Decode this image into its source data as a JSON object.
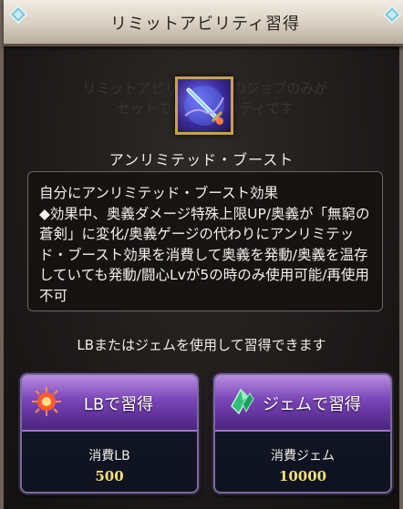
{
  "dialog": {
    "title": "リミットアビリティ習得",
    "background_text": "リミットアビリティはこのジョブのみが\nセットできるアビリティです"
  },
  "skill": {
    "icon": "sword-burst-icon",
    "name": "アンリミテッド・ブースト",
    "description": "自分にアンリミテッド・ブースト効果\n◆効果中、奥義ダメージ特殊上限UP/奥義が「無窮の蒼剣」に変化/奥義ゲージの代わりにアンリミテッド・ブースト効果を消費して奥義を発動/奥義を温存していても発動/闘心Lvが5の時のみ使用可能/再使用不可"
  },
  "learn_note": "LBまたはジェムを使用して習得できます",
  "buttons": {
    "lb": {
      "label": "LBで習得",
      "icon": "lb-burst-icon",
      "cost_label": "消費LB",
      "cost_value": "500"
    },
    "gem": {
      "label": "ジェムで習得",
      "icon": "gem-crystal-icon",
      "cost_label": "消費ジェム",
      "cost_value": "10000"
    }
  },
  "colors": {
    "title_bar": "#d8cfc2",
    "button_purple": "#7a45b8",
    "cost_yellow": "#f4e07a",
    "frame_gold": "#c9a24a"
  }
}
